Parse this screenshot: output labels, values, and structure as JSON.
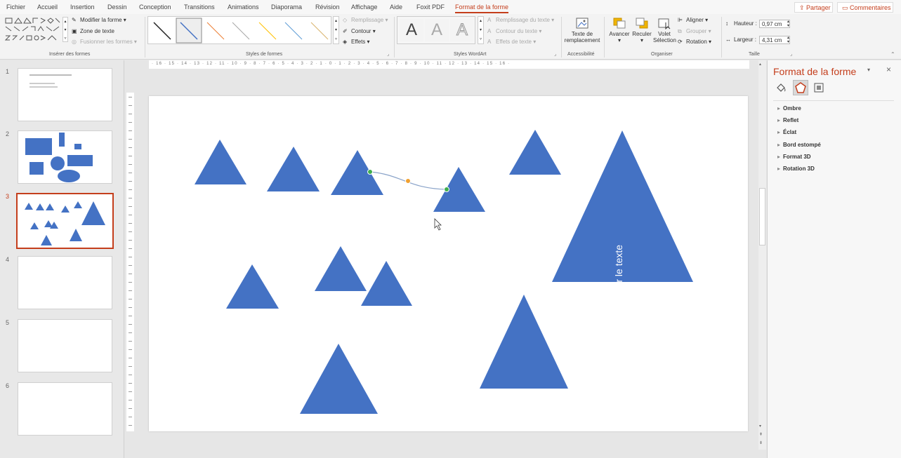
{
  "menu": {
    "tabs": [
      "Fichier",
      "Accueil",
      "Insertion",
      "Dessin",
      "Conception",
      "Transitions",
      "Animations",
      "Diaporama",
      "Révision",
      "Affichage",
      "Aide",
      "Foxit PDF",
      "Format de la forme"
    ],
    "share": "Partager",
    "comments": "Commentaires"
  },
  "ribbon": {
    "insert_shapes": {
      "modify_shape": "Modifier la forme",
      "text_box": "Zone de texte",
      "merge_shapes": "Fusionner les formes",
      "label": "Insérer des formes"
    },
    "shape_styles": {
      "fill": "Remplissage",
      "outline": "Contour",
      "effects": "Effets",
      "label": "Styles de formes"
    },
    "wordart": {
      "letters": [
        "A",
        "A",
        "A"
      ],
      "text_fill": "Remplissage du texte",
      "text_outline": "Contour du texte",
      "text_effects": "Effets de texte",
      "label": "Styles WordArt"
    },
    "accessibility": {
      "alt_text_line1": "Texte de",
      "alt_text_line2": "remplacement",
      "label": "Accessibilité"
    },
    "arrange": {
      "forward": "Avancer",
      "backward": "Reculer",
      "pane_line1": "Volet",
      "pane_line2": "Sélection",
      "align": "Aligner",
      "group": "Grouper",
      "rotate": "Rotation",
      "label": "Organiser"
    },
    "size": {
      "height_label": "Hauteur :",
      "height_value": "0,97 cm",
      "width_label": "Largeur :",
      "width_value": "4,31 cm",
      "label": "Taille"
    }
  },
  "ruler_ticks": "· 16 · 15 · 14 · 13 · 12 · 11 · 10 · 9 · 8 · 7 · 6 · 5 · 4 · 3 · 2 · 1 · 0 · 1 · 2 · 3 · 4 · 5 · 6 · 7 · 8 · 9 · 10 · 11 · 12 · 13 · 14 · 15 · 16 ·",
  "slides": [
    {
      "number": "1"
    },
    {
      "number": "2"
    },
    {
      "number": "3"
    },
    {
      "number": "4"
    },
    {
      "number": "5"
    },
    {
      "number": "6"
    }
  ],
  "slide": {
    "big_triangle_text": "Taper le texte",
    "shape_color": "#4472c4"
  },
  "format_pane": {
    "title": "Format de la forme",
    "sections": [
      "Ombre",
      "Reflet",
      "Éclat",
      "Bord estompé",
      "Format 3D",
      "Rotation 3D"
    ]
  }
}
